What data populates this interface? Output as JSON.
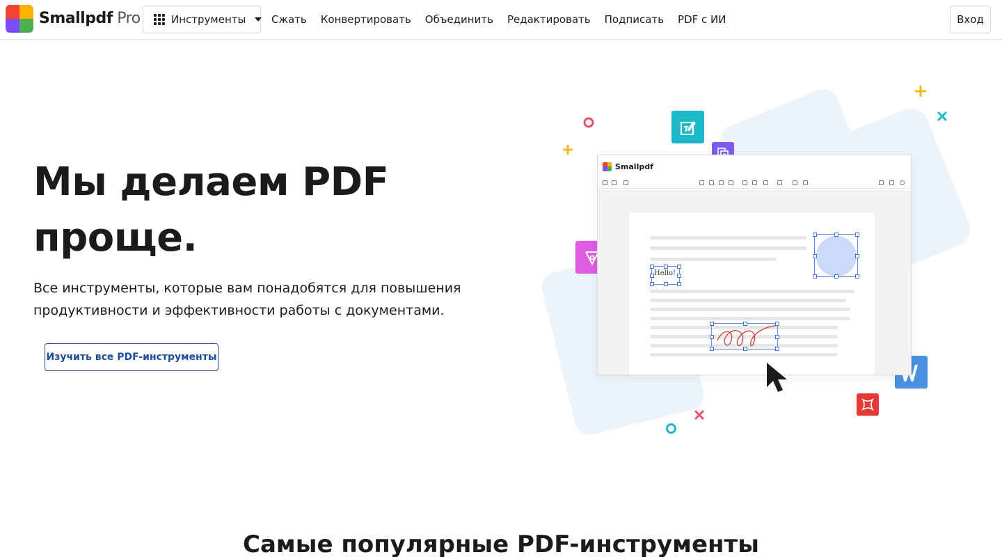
{
  "header": {
    "brand_name": "Smallpdf",
    "brand_tier": "Pro",
    "tools_label": "Инструменты",
    "nav": [
      "Сжать",
      "Конвертировать",
      "Объединить",
      "Редактировать",
      "Подписать",
      "PDF с ИИ"
    ],
    "login_label": "Вход"
  },
  "hero": {
    "title": "Мы делаем PDF проще.",
    "subtitle": "Все инструменты, которые вам понадобятся для повышения продуктивности и эффективности работы с документами.",
    "cta_label": "Изучить все PDF-инструменты"
  },
  "illustration": {
    "app_name": "Smallpdf",
    "sample_text": "Hello!"
  },
  "section": {
    "title": "Самые популярные PDF-инструменты"
  },
  "colors": {
    "primary": "#1c4b9c",
    "logo": [
      "#f44336",
      "#ff9800",
      "#4caf50",
      "#03a9f4",
      "#9c27b0",
      "#e91e63"
    ],
    "badge_edit": "#1cb9c8",
    "badge_copy": "#7a5cf0",
    "badge_pen": "#e15be3",
    "badge_image": "#fbbc05",
    "badge_word": "#4a90e2",
    "badge_shape": "#e53935"
  }
}
